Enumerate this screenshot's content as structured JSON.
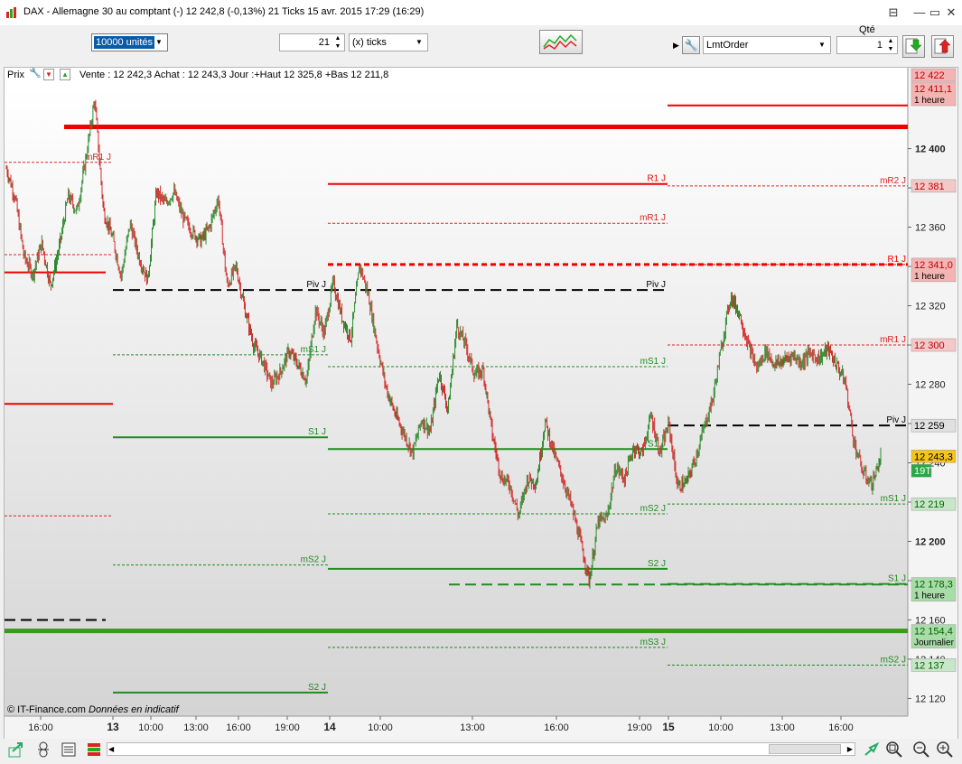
{
  "window": {
    "title": "DAX - Allemagne 30 au comptant (-)   12 242,8 (-0,13%)   21 Ticks  15 avr. 2015 17:29 (16:29)"
  },
  "toolbar": {
    "units_value": "10000 unités",
    "ticks_value": "21",
    "ticks_mode": "(x) ticks",
    "qty_label": "Qté",
    "order_type": "LmtOrder",
    "qty_value": "1"
  },
  "chart_header": {
    "label": "Prix",
    "info": "Vente : 12 242,3 Achat : 12 243,3 Jour :+Haut 12 325,8 +Bas 12 211,8"
  },
  "copyright": {
    "source": "© IT-Finance.com",
    "note": "Données en indicatif"
  },
  "chart_data": {
    "type": "candlestick",
    "y_axis": {
      "ticks": [
        "12 400",
        "12 380",
        "12 360",
        "12 340",
        "12 320",
        "12 300",
        "12 280",
        "12 260",
        "12 240",
        "12 220",
        "12 200",
        "12 180",
        "12 160",
        "12 140",
        "12 120"
      ],
      "ylim": [
        12111,
        12432
      ]
    },
    "x_axis": {
      "ticks": [
        "16:00",
        "13",
        "10:00",
        "13:00",
        "16:00",
        "19:00",
        "14",
        "10:00",
        "13:00",
        "16:00",
        "19:00",
        "15",
        "10:00",
        "13:00",
        "16:00"
      ]
    },
    "price_tags": [
      {
        "text": "12 422",
        "price": 12422,
        "bg": "#f4b4b4",
        "fg": "#c00000"
      },
      {
        "text": "12 411,1",
        "sub": "1 heure",
        "price": 12411.1,
        "bg": "#f4b4b4",
        "fg": "#c00000"
      },
      {
        "text": "12 381",
        "price": 12381,
        "bg": "#f4c8c8",
        "fg": "#c00000"
      },
      {
        "text": "12 341,0",
        "sub": "1 heure",
        "price": 12341,
        "bg": "#f4b4b4",
        "fg": "#c00000"
      },
      {
        "text": "12 300",
        "price": 12300,
        "bg": "#f4c8c8",
        "fg": "#c00000"
      },
      {
        "text": "12 259",
        "price": 12259,
        "bg": "#e0e0e0",
        "fg": "#000000"
      },
      {
        "text": "12 243,3",
        "price": 12243.3,
        "bg": "#f5c518",
        "fg": "#000000"
      },
      {
        "text": "19T",
        "price": 12236,
        "bg": "#27a844",
        "fg": "#ffffff"
      },
      {
        "text": "12 219",
        "price": 12219,
        "bg": "#c8e6c8",
        "fg": "#006400"
      },
      {
        "text": "12 178,3",
        "sub": "1 heure",
        "price": 12178.3,
        "bg": "#a8dca8",
        "fg": "#006400"
      },
      {
        "text": "12 154,4",
        "sub": "Journalier",
        "price": 12154.4,
        "bg": "#a8dca8",
        "fg": "#006400"
      },
      {
        "text": "12 137",
        "price": 12137,
        "bg": "#c8e6c8",
        "fg": "#006400"
      }
    ],
    "levels": [
      {
        "label": "mR1 J",
        "price": 12393,
        "x": [
          "16:00",
          "19:00"
        ],
        "color": "#dd2222",
        "style": "dotted"
      },
      {
        "label": "",
        "price": 12346,
        "x": [
          "16:00",
          "19:00"
        ],
        "color": "#dd2222",
        "style": "dotted"
      },
      {
        "label": "",
        "price": 12270,
        "x": [
          "16:00",
          "19:00"
        ],
        "color": "#ee0000",
        "style": "solid"
      },
      {
        "label": "",
        "price": 12213,
        "x": [
          "16:00",
          "19:00"
        ],
        "color": "#dd2222",
        "style": "dotted"
      },
      {
        "label": "",
        "price": 12337,
        "x": [
          "16:00",
          "13"
        ],
        "color": "#ee0000",
        "style": "solid"
      },
      {
        "label": "",
        "price": 12160,
        "x": [
          "16:00",
          "13"
        ],
        "color": "#000000",
        "style": "dashed"
      },
      {
        "label": "Piv J",
        "price": 12328,
        "x": [
          "13",
          "19:00"
        ],
        "color": "#000000",
        "style": "dashed"
      },
      {
        "label": "mS1 J",
        "price": 12295,
        "x": [
          "13",
          "19:00"
        ],
        "color": "#228b22",
        "style": "dotted"
      },
      {
        "label": "S1 J",
        "price": 12253,
        "x": [
          "13",
          "19:00"
        ],
        "color": "#228b22",
        "style": "solid"
      },
      {
        "label": "mS2 J",
        "price": 12188,
        "x": [
          "13",
          "19:00"
        ],
        "color": "#228b22",
        "style": "dotted"
      },
      {
        "label": "S2 J",
        "price": 12123,
        "x": [
          "13",
          "19:00"
        ],
        "color": "#228b22",
        "style": "solid"
      },
      {
        "label": "R1 J",
        "price": 12382,
        "x": [
          "14",
          "19:00"
        ],
        "color": "#ee0000",
        "style": "solid"
      },
      {
        "label": "mR1 J",
        "price": 12362,
        "x": [
          "14",
          "19:00"
        ],
        "color": "#dd2222",
        "style": "dotted"
      },
      {
        "label": "Piv J",
        "price": 12328,
        "x": [
          "14",
          "19:00"
        ],
        "color": "#000000",
        "style": "dashed"
      },
      {
        "label": "mS1 J",
        "price": 12289,
        "x": [
          "14",
          "19:00"
        ],
        "color": "#228b22",
        "style": "dotted"
      },
      {
        "label": "S1 J",
        "price": 12247,
        "x": [
          "14",
          "19:00"
        ],
        "color": "#228b22",
        "style": "solid"
      },
      {
        "label": "mS2 J",
        "price": 12214,
        "x": [
          "14",
          "19:00"
        ],
        "color": "#228b22",
        "style": "dotted"
      },
      {
        "label": "S2 J",
        "price": 12186,
        "x": [
          "14",
          "19:00"
        ],
        "color": "#228b22",
        "style": "solid"
      },
      {
        "label": "mS3 J",
        "price": 12146,
        "x": [
          "14",
          "19:00"
        ],
        "color": "#228b22",
        "style": "dotted"
      },
      {
        "label": "mR2 J",
        "price": 12381,
        "x": [
          "15",
          "end"
        ],
        "color": "#dd2222",
        "style": "dotted"
      },
      {
        "label": "R1 J",
        "price": 12341,
        "x": [
          "15",
          "end"
        ],
        "color": "#ee0000",
        "style": "dotted"
      },
      {
        "label": "mR1 J",
        "price": 12300,
        "x": [
          "15",
          "end"
        ],
        "color": "#dd2222",
        "style": "dotted"
      },
      {
        "label": "Piv J",
        "price": 12259,
        "x": [
          "15",
          "end"
        ],
        "color": "#000000",
        "style": "dashed"
      },
      {
        "label": "mS1 J",
        "price": 12219,
        "x": [
          "15",
          "end"
        ],
        "color": "#228b22",
        "style": "dotted"
      },
      {
        "label": "S1 J",
        "price": 12178.3,
        "x": [
          "15",
          "end"
        ],
        "color": "#228b22",
        "style": "dashed"
      },
      {
        "label": "mS2 J",
        "price": 12137,
        "x": [
          "15",
          "end"
        ],
        "color": "#228b22",
        "style": "dotted"
      },
      {
        "label": "",
        "price": 12341,
        "x": [
          "14",
          "19:00"
        ],
        "color": "#ee0000",
        "style": "dashed"
      },
      {
        "label": "",
        "price": 12178,
        "x": [
          "13:00",
          "19:00"
        ],
        "color": "#228b22",
        "style": "dashed"
      },
      {
        "label": "",
        "price": 12422,
        "x": [
          "15",
          "end"
        ],
        "color": "#ee0000",
        "style": "solid"
      },
      {
        "label": "",
        "price": 12411.1,
        "x": [
          "start",
          "end"
        ],
        "color": "#ee0000",
        "style": "thick"
      },
      {
        "label": "",
        "price": 12154.4,
        "x": [
          "start",
          "end"
        ],
        "color": "#3a9a1a",
        "style": "thick"
      }
    ],
    "price_path": [
      12390,
      12375,
      12345,
      12336,
      12352,
      12330,
      12350,
      12376,
      12368,
      12395,
      12425,
      12368,
      12355,
      12335,
      12362,
      12345,
      12333,
      12378,
      12372,
      12378,
      12365,
      12358,
      12353,
      12360,
      12375,
      12330,
      12340,
      12318,
      12300,
      12292,
      12280,
      12286,
      12297,
      12290,
      12282,
      12318,
      12306,
      12332,
      12314,
      12303,
      12341,
      12325,
      12300,
      12278,
      12265,
      12255,
      12245,
      12262,
      12256,
      12286,
      12267,
      12310,
      12300,
      12285,
      12287,
      12255,
      12233,
      12229,
      12213,
      12232,
      12230,
      12261,
      12245,
      12232,
      12218,
      12200,
      12180,
      12210,
      12212,
      12238,
      12232,
      12248,
      12245,
      12264,
      12245,
      12260,
      12228,
      12230,
      12242,
      12258,
      12273,
      12300,
      12325,
      12316,
      12300,
      12288,
      12297,
      12290,
      12292,
      12295,
      12291,
      12296,
      12293,
      12298,
      12290,
      12281,
      12250,
      12235,
      12229,
      12243
    ]
  },
  "colors": {
    "bull": "#2e8b2e",
    "bear": "#d22c2c",
    "resistance": "#ee0000",
    "support": "#228b22"
  }
}
